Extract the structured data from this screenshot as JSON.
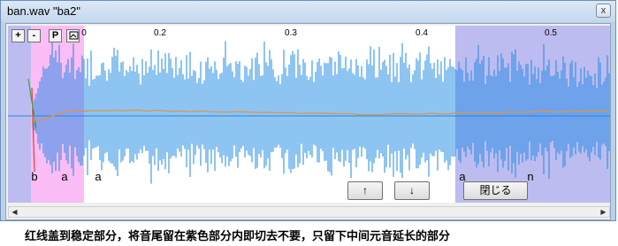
{
  "window": {
    "title": "ban.wav \"ba2\"",
    "close_glyph": "x"
  },
  "toolbar": {
    "zoom_in": "+",
    "zoom_out": "-",
    "play": "P",
    "icon": "image-icon"
  },
  "ruler": {
    "ticks": [
      "0.2",
      "0.3",
      "0.4",
      "0.5"
    ],
    "partial_label": "0"
  },
  "phones": [
    "b",
    "a",
    "a",
    "a",
    "n"
  ],
  "buttons": {
    "up": "↑",
    "down": "↓",
    "close": "閉じる"
  },
  "colors": {
    "region_purple": "#bdbcf0",
    "region_pink": "#fbbdf5",
    "waveform": "#1e88e5",
    "envelope": "#e8913a"
  },
  "caption": "红线盖到稳定部分，将音尾留在紫色部分内即切去不要，只留下中间元音延长的部分"
}
